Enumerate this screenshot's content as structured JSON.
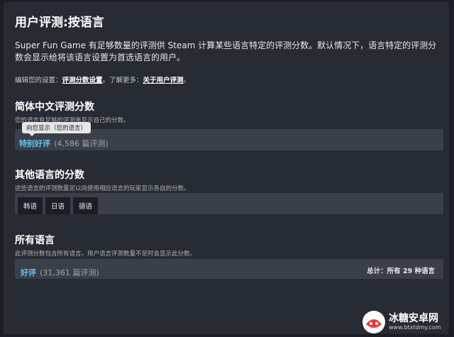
{
  "page": {
    "title": "用户评测:按语言",
    "description": "Super Fun Game 有足够数量的评测供 Steam 计算某些语言特定的评测分数。默认情况下，语言特定的评测分数会显示给将该语言设置为首选语言的用户。",
    "settings_prefix": "编辑您的设置：",
    "settings_link": "评测分数设置",
    "settings_middle": "。了解更多：",
    "about_link": "关于用户评测",
    "settings_suffix": "。"
  },
  "simplified": {
    "title": "简体中文评测分数",
    "subtitle": "您的语言有足够的评测来显示自己的分数。",
    "tooltip": "向您显示（您的语言）",
    "score": "特别好评",
    "count": "(4,586 篇评测)"
  },
  "other": {
    "title": "其他语言的分数",
    "subtitle": "这些语言的评测数量足以向使用相应语言的玩家显示各自的分数。",
    "languages": [
      "韩语",
      "日语",
      "德语"
    ]
  },
  "all": {
    "title": "所有语言",
    "subtitle": "此评测分数包含所有语言。用户语言评测数量不足时会显示此分数。",
    "score": "好评",
    "count": "(31,361 篇评测)",
    "total": "总计：所有 29 种语言"
  },
  "watermark": {
    "name": "冰糖安卓网",
    "url": "www.btxtdmy.com"
  }
}
